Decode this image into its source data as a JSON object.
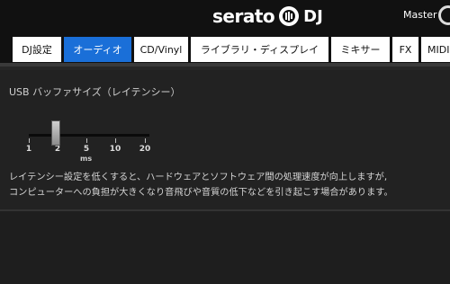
{
  "header": {
    "logo_text": "serato",
    "logo_suffix": "DJ",
    "master_label": "Master"
  },
  "tabs": [
    {
      "label": "DJ設定"
    },
    {
      "label": "オーディオ",
      "active": true
    },
    {
      "label": "CD/Vinyl"
    },
    {
      "label": "ライブラリ・ディスプレイ"
    },
    {
      "label": "ミキサー"
    },
    {
      "label": "FX"
    },
    {
      "label": "MIDI"
    }
  ],
  "usb_buffer": {
    "title": "USB バッファサイズ（レイテンシー）",
    "ticks": [
      "1",
      "2",
      "5",
      "10",
      "20"
    ],
    "unit": "ms",
    "selected": "2"
  },
  "description": {
    "line1": "レイテンシー設定を低くすると、ハードウェアとソフトウェア間の処理速度が向上しますが,",
    "line2": "コンピューターへの負担が大きくなり音飛びや音質の低下などを引き起こす場合があります。"
  },
  "colors": {
    "active_tab": "#1a6fd8",
    "background": "#262626"
  }
}
